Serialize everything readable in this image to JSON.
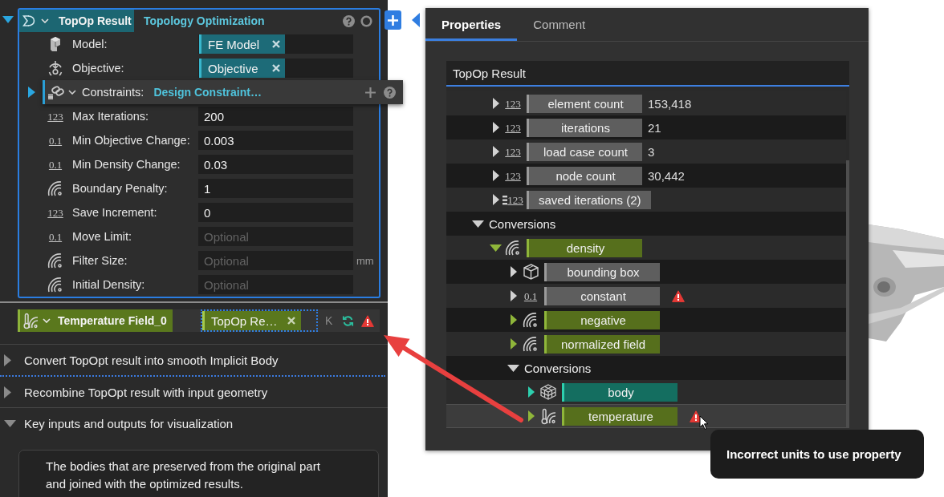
{
  "node": {
    "expanded": true,
    "selected": true,
    "title": "TopOp Result",
    "subtitle": "Topology Optimization",
    "inputs": [
      {
        "kind": "model",
        "label": "Model:",
        "tag": "FE Model"
      },
      {
        "kind": "objective",
        "label": "Objective:",
        "tag": "Objective"
      },
      {
        "kind": "constraints",
        "label": "Constraints:",
        "value": "Design Constraint…",
        "expanded": false
      },
      {
        "kind": "number",
        "glyph": "123",
        "label": "Max Iterations:",
        "value": "200"
      },
      {
        "kind": "number",
        "glyph": "0.1",
        "label": "Min Objective Change:",
        "value": "0.003"
      },
      {
        "kind": "number",
        "glyph": "0.1",
        "label": "Min Density Change:",
        "value": "0.03"
      },
      {
        "kind": "field",
        "label": "Boundary Penalty:",
        "value": "1"
      },
      {
        "kind": "number",
        "glyph": "123",
        "label": "Save Increment:",
        "value": "0"
      },
      {
        "kind": "number",
        "glyph": "0.1",
        "label": "Move Limit:",
        "placeholder": "Optional"
      },
      {
        "kind": "field",
        "label": "Filter Size:",
        "placeholder": "Optional",
        "unit": "mm"
      },
      {
        "kind": "field",
        "label": "Initial Density:",
        "placeholder": "Optional"
      }
    ]
  },
  "temperature_node": {
    "title": "Temperature Field_0",
    "input_tag": "TopOp Re…",
    "status_letter": "K",
    "warning": true
  },
  "sections": [
    {
      "title": "Convert TopOpt result into smooth Implicit Body",
      "expanded": false,
      "drop_indicator": true
    },
    {
      "title": "Recombine TopOpt result with input geometry",
      "expanded": false,
      "drop_indicator": false
    },
    {
      "title": "Key inputs and outputs for visualization",
      "expanded": true,
      "drop_indicator": false,
      "description": "The bodies that are preserved from the original part and joined with the optimized results."
    }
  ],
  "properties_panel": {
    "tabs": [
      {
        "label": "Properties",
        "selected": true
      },
      {
        "label": "Comment",
        "selected": false
      }
    ],
    "title": "TopOp Result",
    "tree": {
      "continued_rows": [
        {
          "kind": "number",
          "glyph": "123",
          "label": "element count",
          "value": "153,418",
          "expanded": false,
          "warning": false,
          "hovered": false
        },
        {
          "kind": "number",
          "glyph": "123",
          "label": "iterations",
          "value": "21",
          "expanded": false,
          "warning": false,
          "hovered": false
        },
        {
          "kind": "number",
          "glyph": "123",
          "label": "load case count",
          "value": "3",
          "expanded": false,
          "warning": false,
          "hovered": false
        },
        {
          "kind": "number",
          "glyph": "123",
          "label": "node count",
          "value": "30,442",
          "expanded": false,
          "warning": false,
          "hovered": false
        },
        {
          "kind": "number_list",
          "glyph": "123",
          "label": "saved iterations (2)",
          "expanded": false,
          "warning": false,
          "hovered": false
        }
      ],
      "nodes": [
        {
          "kind": "group",
          "label": "Conversions",
          "expanded": true,
          "warning": false,
          "hovered": false,
          "children": [
            {
              "kind": "field",
              "label": "density",
              "expanded": true,
              "warning": false,
              "hovered": false,
              "children": [
                {
                  "kind": "box",
                  "label": "bounding box",
                  "expanded": false,
                  "warning": false,
                  "hovered": false
                },
                {
                  "kind": "number",
                  "glyph": "0.1",
                  "label": "constant",
                  "expanded": false,
                  "warning": true,
                  "hovered": false
                },
                {
                  "kind": "field",
                  "label": "negative",
                  "expanded": false,
                  "warning": false,
                  "hovered": false
                },
                {
                  "kind": "field",
                  "label": "normalized field",
                  "expanded": false,
                  "warning": false,
                  "hovered": false
                },
                {
                  "kind": "group",
                  "label": "Conversions",
                  "expanded": true,
                  "warning": false,
                  "hovered": false,
                  "children": [
                    {
                      "kind": "body",
                      "label": "body",
                      "expanded": false,
                      "warning": false,
                      "hovered": false
                    },
                    {
                      "kind": "temperature",
                      "label": "temperature",
                      "expanded": false,
                      "warning": true,
                      "hovered": true
                    }
                  ]
                }
              ]
            }
          ]
        }
      ]
    }
  },
  "tooltip": "Incorrect units to use property"
}
